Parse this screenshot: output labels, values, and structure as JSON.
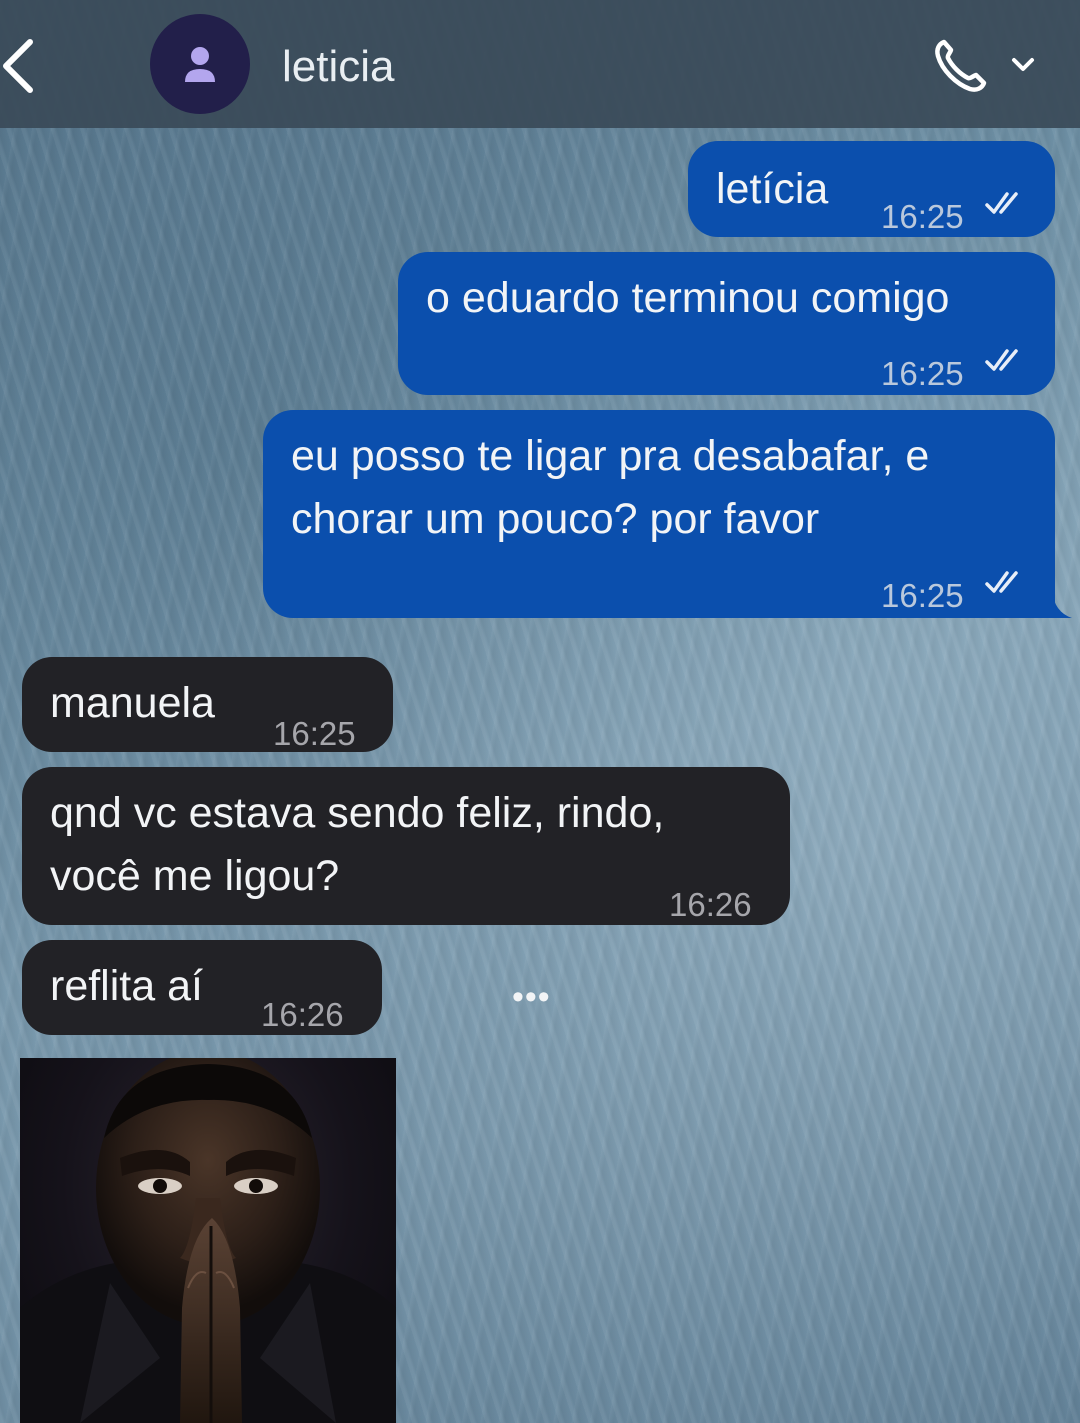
{
  "header": {
    "contact_name": "leticia",
    "back_icon": "chevron-left-icon",
    "avatar_icon": "person-icon",
    "call_icon": "phone-icon",
    "call_menu_icon": "chevron-down-icon"
  },
  "messages": [
    {
      "direction": "outgoing",
      "text": "letícia",
      "time": "16:25",
      "status": "read"
    },
    {
      "direction": "outgoing",
      "text": "o eduardo terminou comigo",
      "time": "16:25",
      "status": "read"
    },
    {
      "direction": "outgoing",
      "lines": [
        "eu posso te ligar pra desabafar, e",
        "chorar um pouco? por favor"
      ],
      "time": "16:25",
      "status": "read"
    },
    {
      "direction": "incoming",
      "text": "manuela",
      "time": "16:25"
    },
    {
      "direction": "incoming",
      "lines": [
        "qnd vc estava sendo feliz, rindo,",
        "você me ligou?"
      ],
      "time": "16:26"
    },
    {
      "direction": "incoming",
      "text": "reflita aí",
      "time": "16:26"
    }
  ],
  "typing_indicator": "•••",
  "image_message": {
    "subject": "man-praying-portrait"
  },
  "colors": {
    "outgoing_bubble": "#0b4fad",
    "incoming_bubble": "#222226",
    "header": "#3a4a58",
    "avatar": "#221f4a",
    "avatar_icon": "#b3a6ee"
  }
}
